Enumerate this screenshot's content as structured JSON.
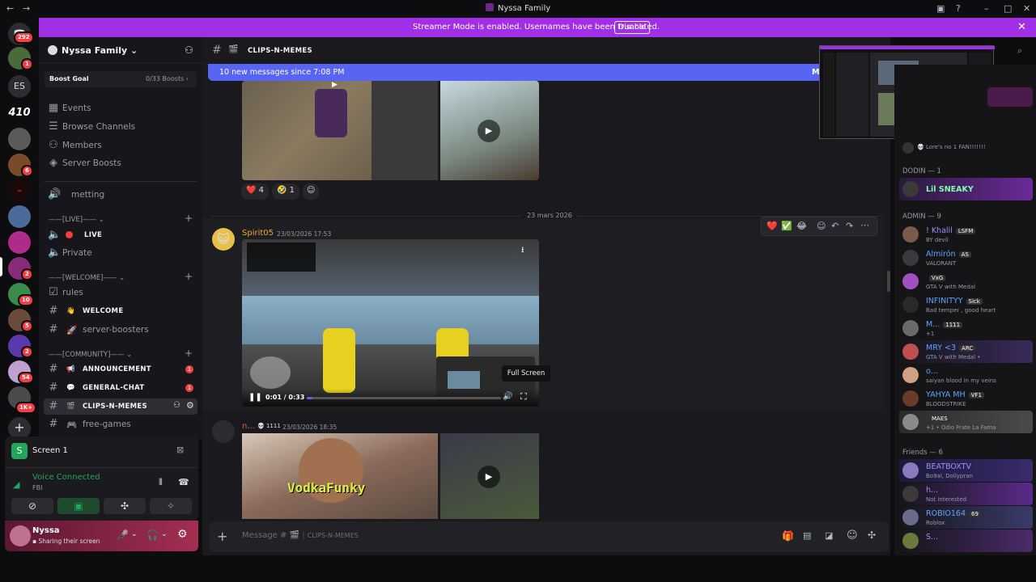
{
  "window": {
    "title": "Nyssa Family"
  },
  "banner": {
    "message": "Streamer Mode is enabled. Usernames have been truncated.",
    "disable": "Disable"
  },
  "guilds": {
    "dm_badge": "292",
    "badge1": "1",
    "es": "ES",
    "badge6": "6",
    "badge2": "2",
    "badge10": "10",
    "badge5": "5",
    "badge2b": "2",
    "badge54": "54",
    "badge1k": "1K+"
  },
  "server": {
    "name": "Nyssa Family",
    "boost_goal": "Boost Goal",
    "boost_count": "0/33 Boosts"
  },
  "nav": [
    "Events",
    "Browse Channels",
    "Members",
    "Server Boosts"
  ],
  "channels": {
    "metting": "metting",
    "live_cat": "——[LIVE]——",
    "live": "LIVE",
    "private": "Private",
    "welcome_cat": "——[WELCOME]——",
    "rules": "rules",
    "welcome": "WELCOME",
    "boosters": "server-boosters",
    "community_cat": "——[COMMUNITY]——",
    "announcement": "ANNOUNCEMENT",
    "general": "GENERAL-CHAT",
    "clips": "CLIPS-N-MEMES",
    "games": "free-games",
    "badge": "1"
  },
  "voice": {
    "screen": "Screen 1",
    "status": "Voice Connected",
    "channel": "FBI"
  },
  "user": {
    "name": "Nyssa",
    "status": "Sharing their screen"
  },
  "header": {
    "channel": "CLIPS-N-MEMES"
  },
  "newbar": {
    "text": "10 new messages since 7:08 PM",
    "mark": "M"
  },
  "messages": {
    "reactions": [
      {
        "emoji": "❤️",
        "count": "4"
      },
      {
        "emoji": "🤣",
        "count": "1"
      }
    ],
    "date": "23 mars 2026",
    "author1": "Spirit05",
    "time1": "23/03/2026 17:53",
    "video_time": "0:01 / 0:33",
    "tooltip": "Full Screen",
    "author2": "n...",
    "tag2": "1111",
    "time2": "23/03/2026 18:35",
    "overlay": "VodkaFunky"
  },
  "composer": {
    "placeholder": "Message #",
    "channel": "CLIPS-N-MEMES"
  },
  "members": {
    "fan": "Lore's no 1 FAN!!!!!!!",
    "dodin": "DODIN — 1",
    "dodin_name": "Lil SNEAKY",
    "admin": "ADMIN — 9",
    "list": [
      {
        "name": "! Khalil",
        "tag": "LSFM",
        "status": "BY devil",
        "color": "#a78bfa"
      },
      {
        "name": "Almirón",
        "tag": "AS",
        "status": "VALORANT",
        "color": "#60a5fa"
      },
      {
        "name": "",
        "tag": "VxG",
        "status": "GTA V with Medal",
        "color": "#f2f3f5"
      },
      {
        "name": "INFINITYY",
        "tag": "Sick",
        "status": "Bad temper , good heart",
        "color": "#60a5fa"
      },
      {
        "name": "M...",
        "tag": "1111",
        "status": "+1",
        "color": "#60a5fa"
      },
      {
        "name": "MRY <3",
        "tag": "ARC",
        "status": "GTA V with Medal •",
        "color": "#60a5fa"
      },
      {
        "name": "o...",
        "tag": "",
        "status": "saiyan blood in my veins",
        "color": "#60a5fa"
      },
      {
        "name": "YAHYA MH",
        "tag": "VF1",
        "status": "BLOODSTRIKE",
        "color": "#60a5fa"
      },
      {
        "name": "",
        "tag": "MAES",
        "status": "+1 • Odio Frate La Fama",
        "color": "#f2f3f5"
      }
    ],
    "friends": "Friends — 6",
    "friends_list": [
      {
        "name": "BEATBOXTV",
        "status": "Bo9al, Dollypran",
        "color": "#a78bfa"
      },
      {
        "name": "h...",
        "status": "Not interested",
        "color": "#a78bfa"
      },
      {
        "name": "ROBIO164",
        "tag": "69",
        "status": "Roblox",
        "color": "#60a5fa"
      },
      {
        "name": "S...",
        "status": "",
        "color": "#a78bfa"
      }
    ]
  }
}
